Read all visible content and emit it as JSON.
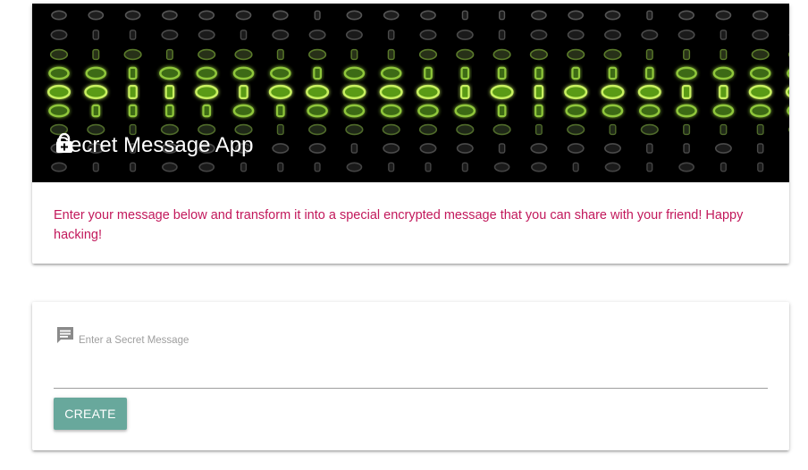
{
  "app": {
    "title": "Secret Message App",
    "description": "Enter your message below and transform it into a special encrypted message that you can share with your friend! Happy hacking!"
  },
  "form": {
    "input_label": "Enter a Secret Message",
    "input_value": "",
    "create_label": "CREATE"
  },
  "icons": {
    "title_icon": "lock-icon",
    "input_icon": "message-icon"
  },
  "colors": {
    "description_text": "#c2185b",
    "button": "#68a89c",
    "binary_green": "#7dbb2a"
  }
}
